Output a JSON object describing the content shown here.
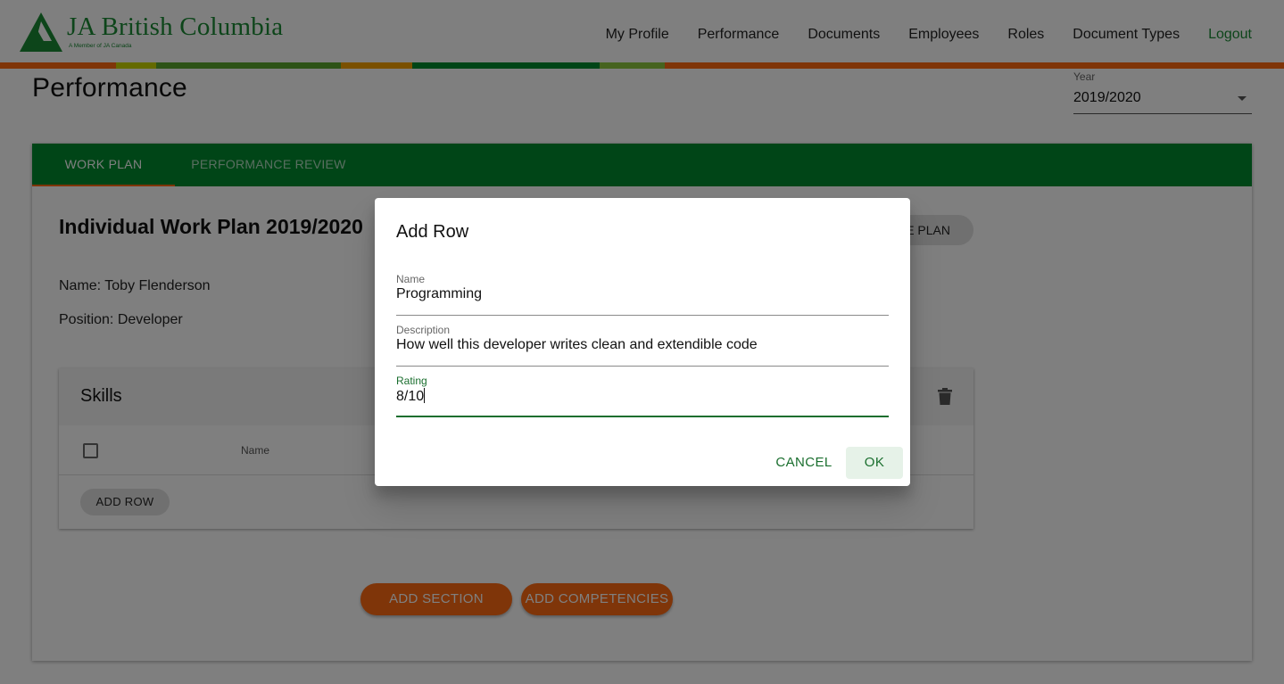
{
  "header": {
    "logo_title": "JA British Columbia",
    "logo_subtitle": "A Member of JA Canada",
    "nav": [
      "My Profile",
      "Performance",
      "Documents",
      "Employees",
      "Roles",
      "Document Types",
      "Logout"
    ]
  },
  "page": {
    "title": "Performance",
    "year_label": "Year",
    "year_value": "2019/2020"
  },
  "tabs": [
    "WORK PLAN",
    "PERFORMANCE REVIEW"
  ],
  "workplan": {
    "title": "Individual Work Plan 2019/2020",
    "plan_button": "E PLAN",
    "name_line": "Name: Toby Flenderson",
    "position_line": "Position: Developer"
  },
  "skills": {
    "title": "Skills",
    "column_name": "Name",
    "add_row": "ADD ROW"
  },
  "actions": {
    "add_section": "ADD SECTION",
    "add_competencies": "ADD COMPETENCIES"
  },
  "dialog": {
    "title": "Add Row",
    "name_label": "Name",
    "name_value": "Programming",
    "description_label": "Description",
    "description_value": "How well this developer writes clean and extendible code",
    "rating_label": "Rating",
    "rating_value": "8/10",
    "cancel": "CANCEL",
    "ok": "OK"
  },
  "colors": {
    "brand_green": "#008a2e",
    "accent_orange": "#ff6a13"
  },
  "icons": [
    "logo-triangle-icon",
    "delete-icon",
    "dropdown-arrow-icon"
  ]
}
